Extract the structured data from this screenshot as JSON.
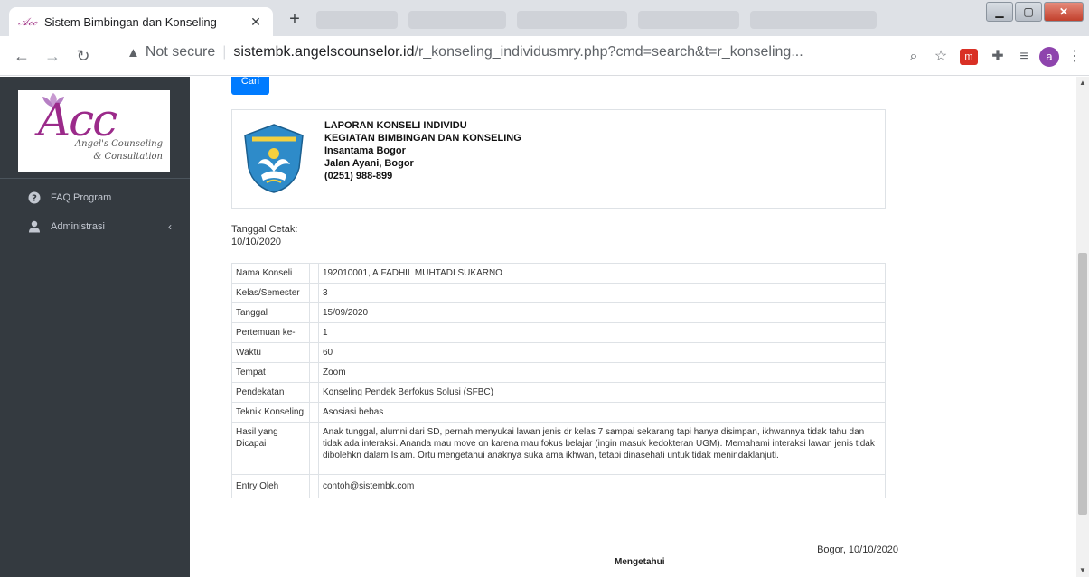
{
  "browser": {
    "tab_favicon": "𝒜𝒸𝒸",
    "tab_title": "Sistem Bimbingan dan Konseling",
    "tab_close": "✕",
    "new_tab": "+",
    "not_secure": "Not secure",
    "url_host": "sistembk.angelscounselor.id",
    "url_rest": "/r_konseling_individusmry.php?cmd=search&t=r_konseling...",
    "profile_initial": "a",
    "ext_label": "m",
    "icons": [
      "back-icon",
      "forward-icon",
      "reload-icon",
      "warning-icon",
      "zoom-icon",
      "star-icon",
      "puzzle-icon",
      "media-icon",
      "menu-icon"
    ]
  },
  "sidebar": {
    "logo_text": "Acc",
    "logo_tagline_1": "Angel's Counseling",
    "logo_tagline_2": "& Consultation",
    "items": [
      {
        "label": "FAQ Program",
        "icon": "question-circle-icon"
      },
      {
        "label": "Administrasi",
        "icon": "user-icon",
        "arrow": "‹"
      }
    ]
  },
  "main": {
    "button_label": "Cari",
    "header": {
      "line1": "LAPORAN KONSELI INDIVIDU",
      "line2": "KEGIATAN BIMBINGAN DAN KONSELING",
      "line3": "Insantama Bogor",
      "line4": "Jalan Ayani, Bogor",
      "line5": "(0251) 988-899"
    },
    "print_label": "Tanggal Cetak:",
    "print_date": "10/10/2020",
    "separator": ":",
    "rows": [
      {
        "label": "Nama Konseli",
        "value": "192010001, A.FADHIL MUHTADI SUKARNO"
      },
      {
        "label": "Kelas/Semester",
        "value": "3"
      },
      {
        "label": "Tanggal",
        "value": "15/09/2020"
      },
      {
        "label": "Pertemuan ke-",
        "value": "1"
      },
      {
        "label": "Waktu",
        "value": "60"
      },
      {
        "label": "Tempat",
        "value": "Zoom"
      },
      {
        "label": "Pendekatan",
        "value": "Konseling Pendek Berfokus Solusi (SFBC)"
      },
      {
        "label": "Teknik Konseling",
        "value": "Asosiasi bebas"
      },
      {
        "label": "Hasil yang Dicapai",
        "value": "Anak tunggal, alumni dari SD, pernah menyukai lawan jenis dr kelas 7 sampai sekarang tapi hanya disimpan, ikhwannya tidak tahu dan tidak ada interaksi. Ananda mau move on karena mau fokus belajar (ingin masuk kedokteran UGM). Memahami interaksi lawan jenis tidak dibolehkn dalam Islam. Ortu mengetahui anaknya suka ama ikhwan, tetapi dinasehati untuk tidak menindaklanjuti."
      },
      {
        "label": "Entry Oleh",
        "value": "contoh@sistembk.com"
      }
    ],
    "place_date": "Bogor, 10/10/2020",
    "acknowledge": "Mengetahui"
  }
}
